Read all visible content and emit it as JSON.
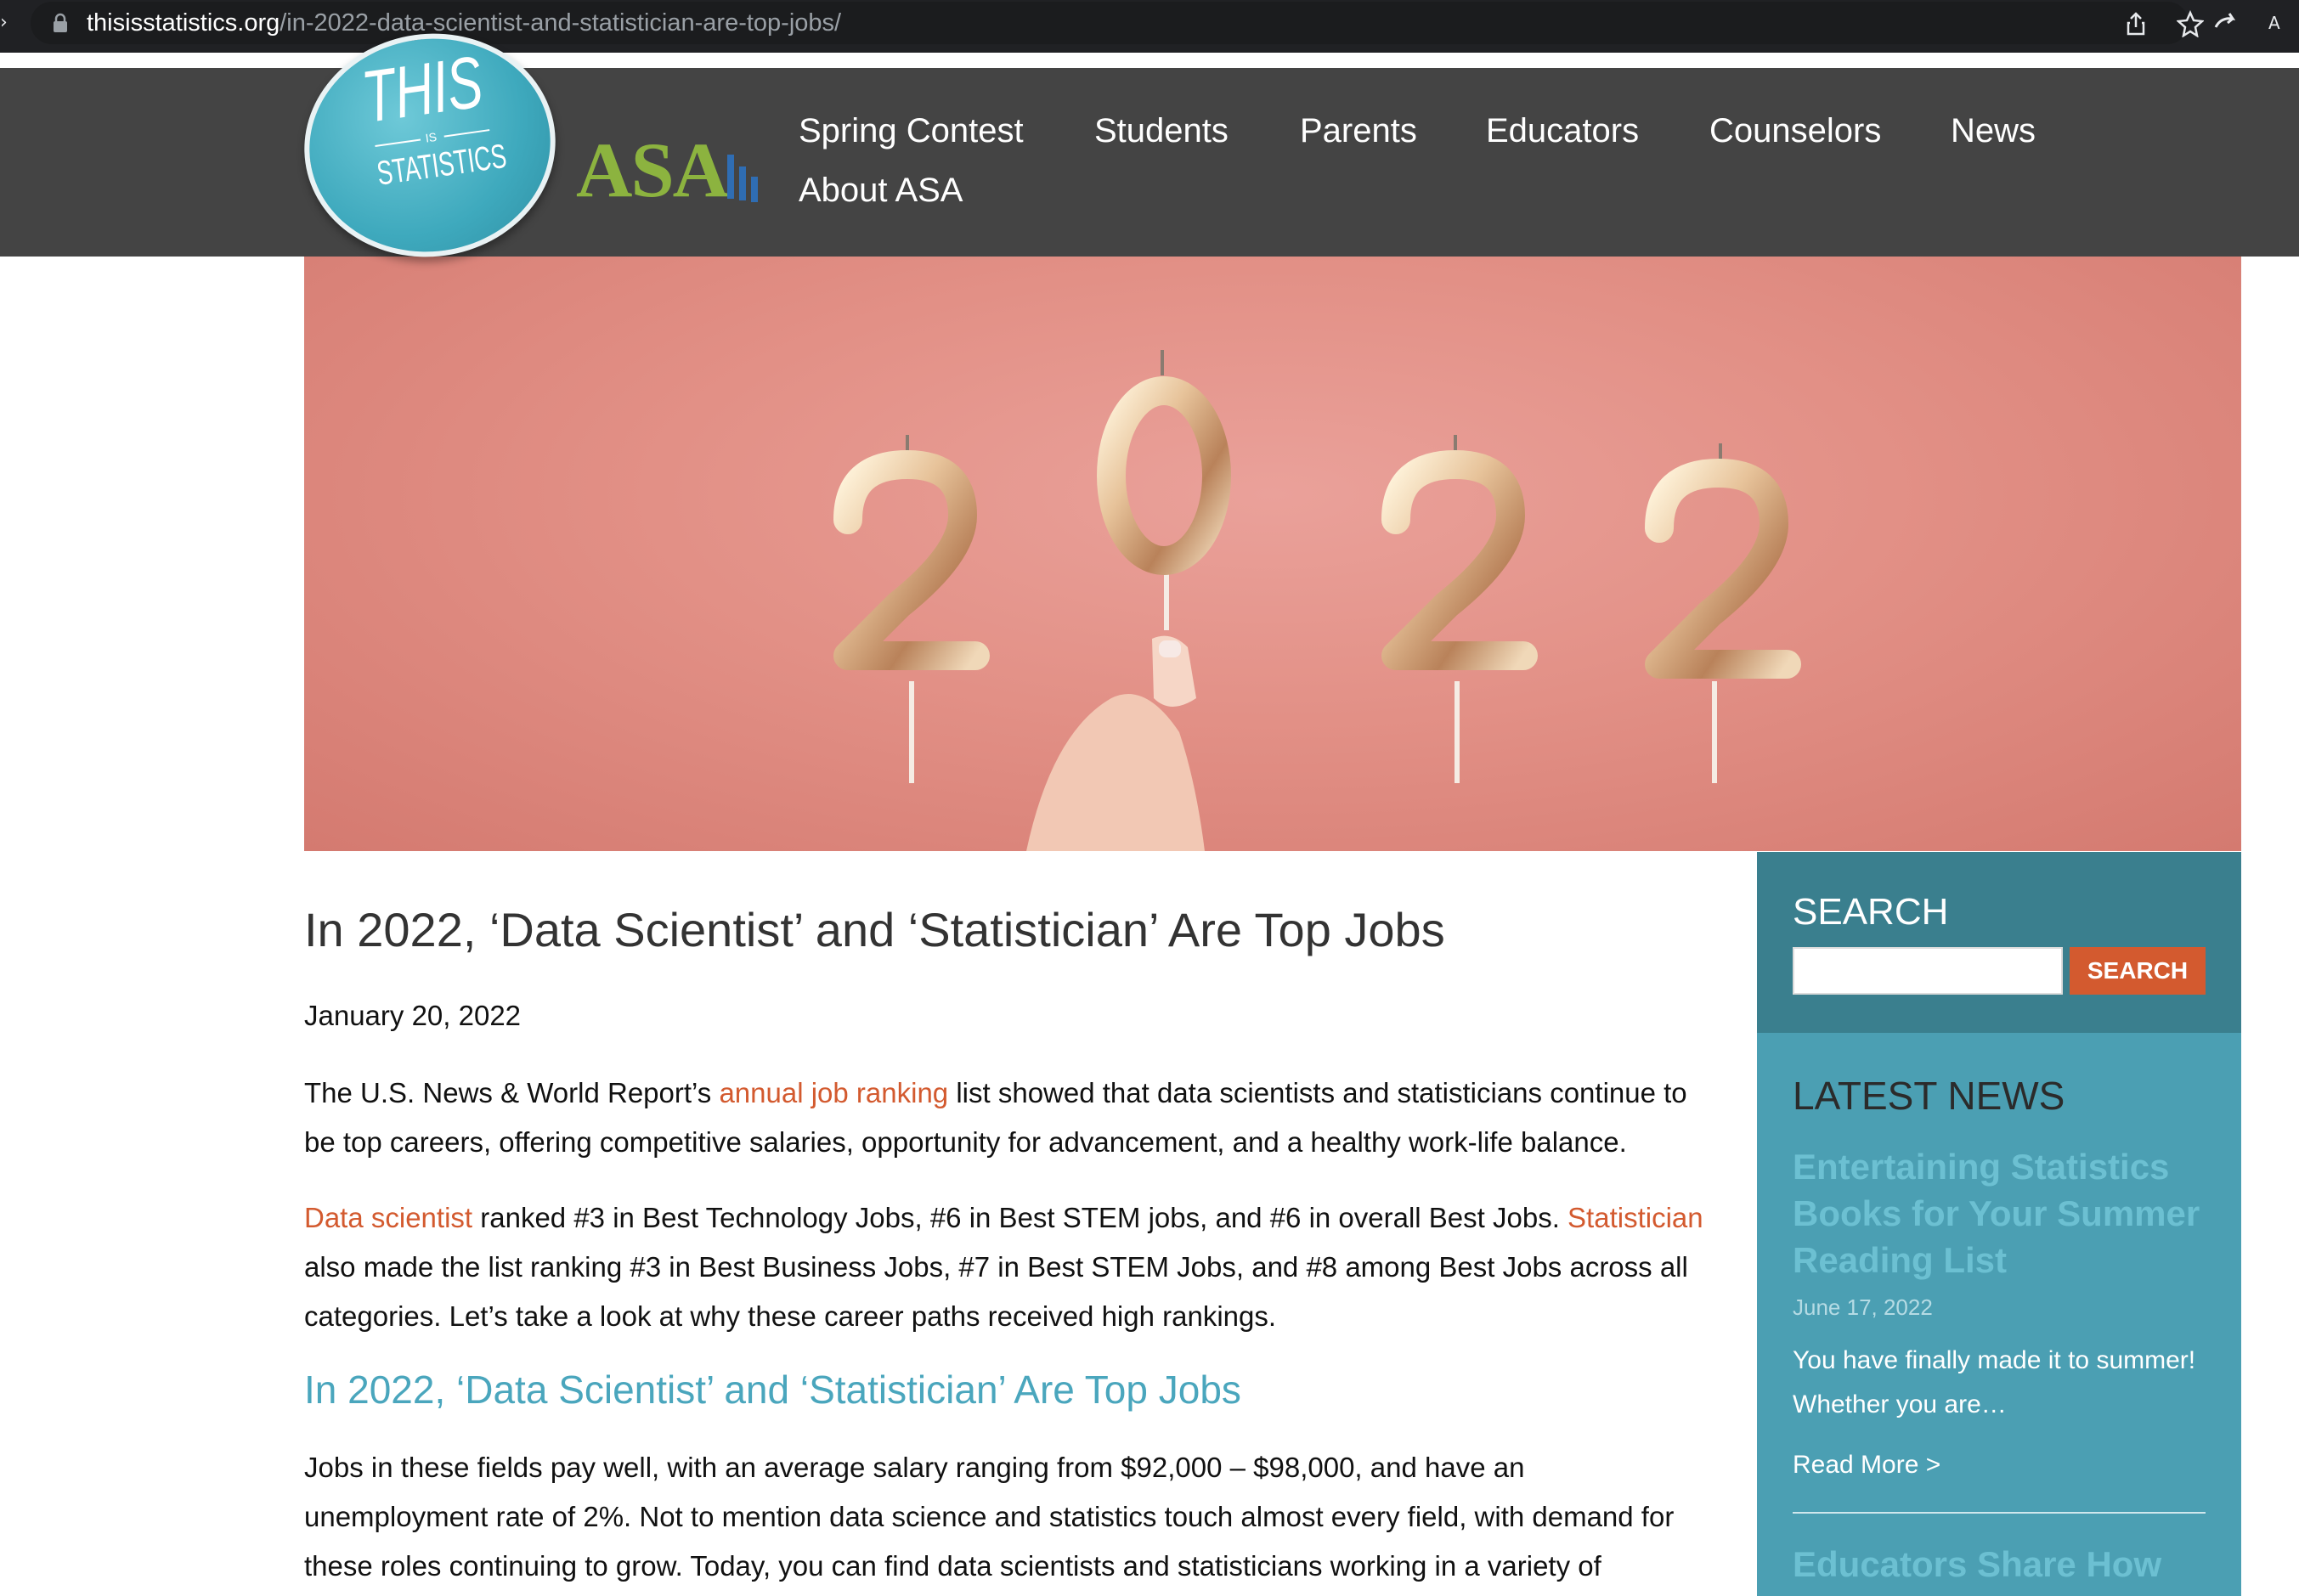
{
  "browser": {
    "url_host": "thisisstatistics.org",
    "url_path": "/in-2022-data-scientist-and-statistician-are-top-jobs/"
  },
  "header": {
    "logo": {
      "top": "THIS",
      "middle": "IS",
      "bottom": "STATISTICS"
    },
    "asa_logo": "ASA",
    "nav": [
      "Spring Contest",
      "Students",
      "Parents",
      "Educators",
      "Counselors",
      "News",
      "About ASA"
    ]
  },
  "hero": {
    "image_label": "2022"
  },
  "article": {
    "title": "In 2022, ‘Data Scientist’ and ‘Statistician’ Are Top Jobs",
    "date": "January 20, 2022",
    "p1": {
      "before": "The U.S. News & World Report’s ",
      "link": "annual job ranking",
      "after": " list showed that data scientists and statisticians continue to be top careers, offering competitive salaries, opportunity for advancement, and a healthy work-life balance."
    },
    "p2": {
      "link1": "Data scientist",
      "middle": " ranked #3 in Best Technology Jobs, #6 in Best STEM jobs, and #6 in overall Best Jobs. ",
      "link2": "Statistician",
      "after": " also made the list ranking #3 in Best Business Jobs, #7 in Best STEM Jobs, and #8 among Best Jobs across all categories. Let’s take a look at why these career paths received high rankings."
    },
    "subheading": "In 2022, ‘Data Scientist’ and ‘Statistician’ Are Top Jobs",
    "p3": "Jobs in these fields pay well, with an average salary ranging from $92,000 – $98,000, and have an unemployment rate of 2%. Not to mention data science and statistics touch almost every field, with demand for these roles continuing to grow. Today, you can find data scientists and statisticians working in a variety of"
  },
  "sidebar": {
    "search_title": "SEARCH",
    "search_button": "SEARCH",
    "search_value": "",
    "news_title": "LATEST NEWS",
    "news_headline": "Entertaining Statistics Books for Your Summer Reading List",
    "news_date": "June 17, 2022",
    "news_excerpt": "You have finally made it to summer! Whether you are…",
    "read_more": "Read More >",
    "news_headline2": "Educators Share How"
  },
  "colors": {
    "header_bg": "#444444",
    "accent_orange": "#d35a2f",
    "teal": "#4b9fb3",
    "teal_dark": "#3a7f8e",
    "asa_green": "#8cb33f"
  }
}
